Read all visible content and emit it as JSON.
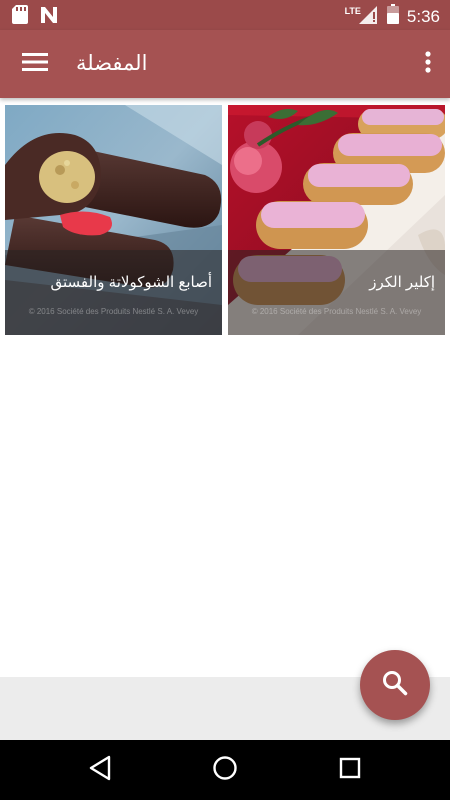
{
  "status_bar": {
    "network": "LTE",
    "time": "5:36",
    "icons": [
      "sd-card-icon",
      "n-notification-icon",
      "signal-icon",
      "battery-icon"
    ]
  },
  "app_bar": {
    "title": "المفضلة",
    "menu_icon": "hamburger-menu-icon",
    "more_icon": "more-vertical-icon"
  },
  "favorites": [
    {
      "title": "أصابع الشوكولاتة والفستق",
      "copyright": "© 2016 Société des Produits Nestlé S. A. Vevey"
    },
    {
      "title": "إكلير الكرز",
      "copyright": "© 2016 Société des Produits Nestlé S. A. Vevey"
    }
  ],
  "fab": {
    "icon": "search-icon"
  },
  "navigation": {
    "icons": [
      "back-icon",
      "home-icon",
      "recents-icon"
    ]
  },
  "colors": {
    "primary": "#a55252",
    "status_bar": "#9b4a4a",
    "strip": "#ececec",
    "nav_bar": "#000000"
  }
}
